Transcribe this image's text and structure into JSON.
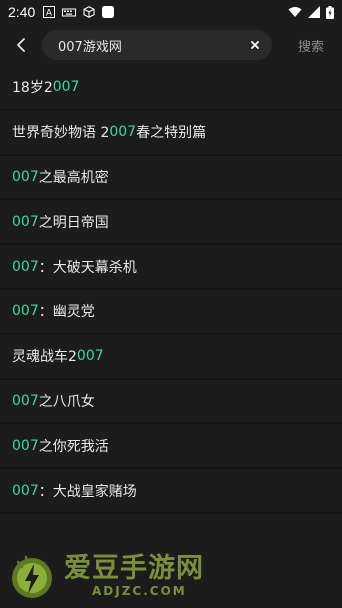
{
  "status_bar": {
    "time": "2:40",
    "icons_left": [
      "text-a-icon",
      "keyboard-icon",
      "box-icon",
      "app-icon"
    ],
    "icons_right": [
      "wifi-icon",
      "signal-icon",
      "battery-icon"
    ]
  },
  "search": {
    "query": "007游戏网",
    "placeholder": "",
    "action_label": "搜索"
  },
  "results": [
    {
      "pre": "18岁2",
      "hl": "007",
      "post": ""
    },
    {
      "pre": "世界奇妙物语 2",
      "hl": "007",
      "post": "春之特别篇"
    },
    {
      "pre": "",
      "hl": "007",
      "post": "之最高机密"
    },
    {
      "pre": "",
      "hl": "007",
      "post": "之明日帝国"
    },
    {
      "pre": "",
      "hl": "007",
      "post": "：大破天幕杀机"
    },
    {
      "pre": "",
      "hl": "007",
      "post": "：幽灵党"
    },
    {
      "pre": "灵魂战车2",
      "hl": "007",
      "post": ""
    },
    {
      "pre": "",
      "hl": "007",
      "post": "之八爪女"
    },
    {
      "pre": "",
      "hl": "007",
      "post": "之你死我活"
    },
    {
      "pre": "",
      "hl": "007",
      "post": "：大战皇家赌场"
    }
  ],
  "colors": {
    "highlight": "#3fd8a0",
    "background": "#1c1c1c",
    "watermark": "#7a8f3c"
  },
  "watermark": {
    "title": "爱豆手游网",
    "subtitle": "ADJZC.COM"
  }
}
